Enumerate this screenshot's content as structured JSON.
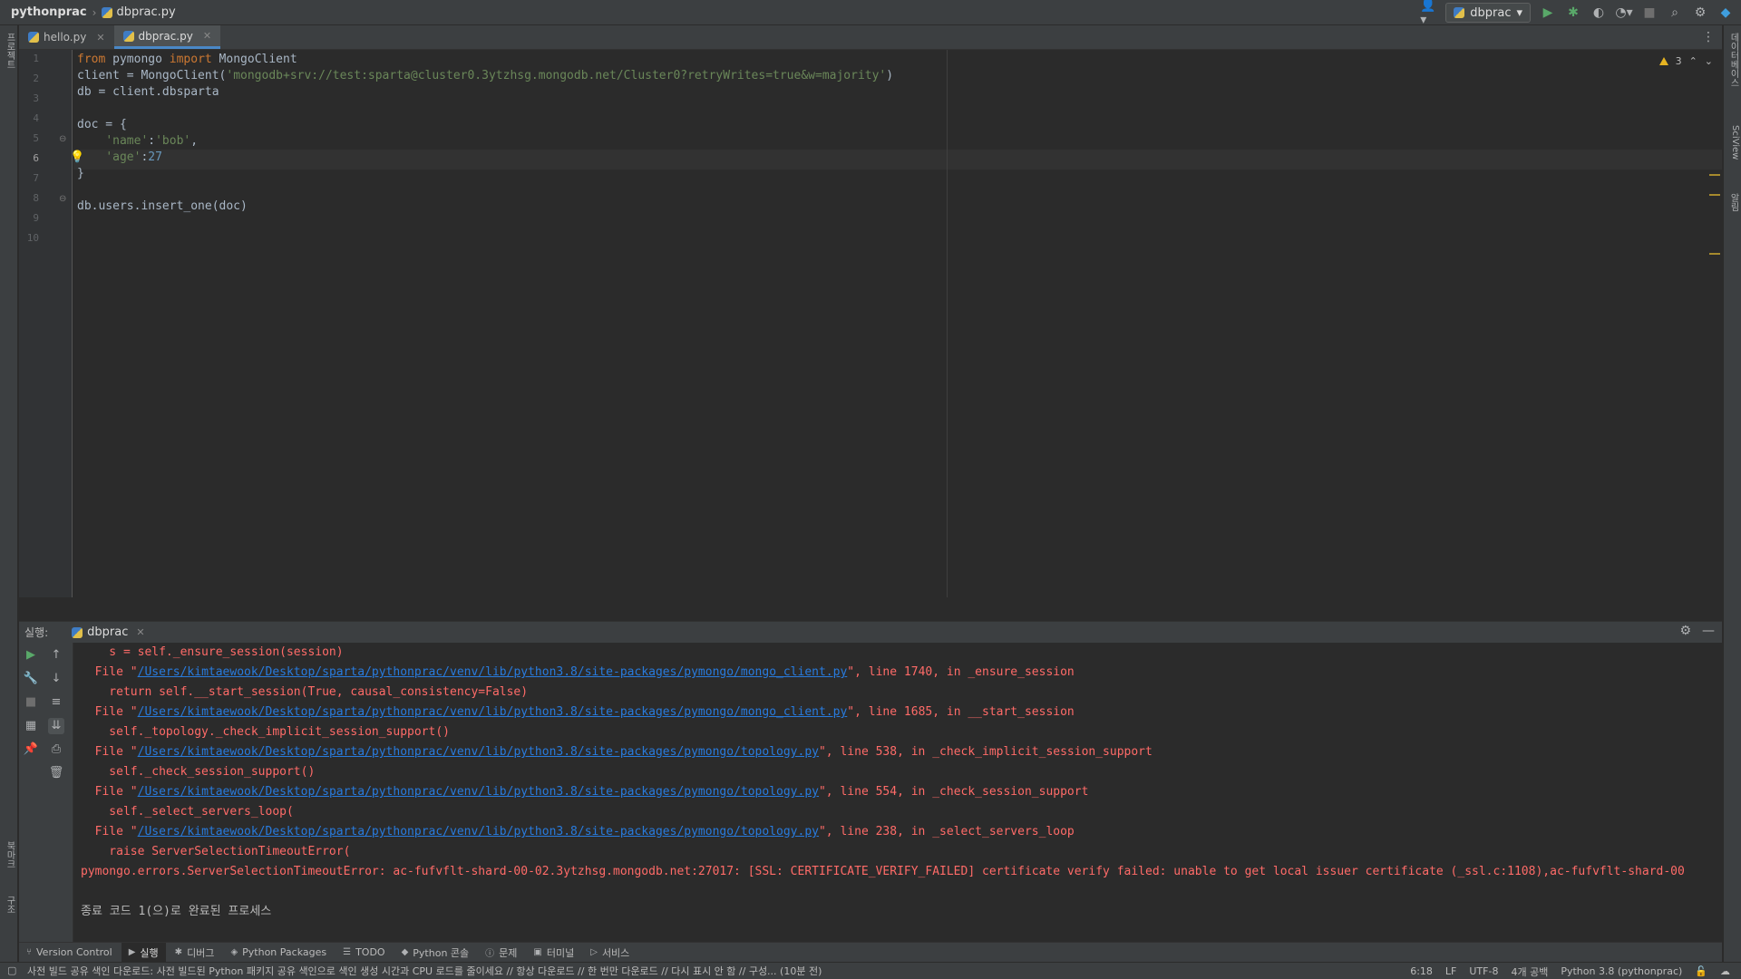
{
  "nav": {
    "project": "pythonprac",
    "file": "dbprac.py",
    "run_config": "dbprac"
  },
  "editor_tabs": [
    {
      "label": "hello.py"
    },
    {
      "label": "dbprac.py"
    }
  ],
  "inspection": {
    "warnings": "3"
  },
  "line_numbers": [
    "1",
    "2",
    "3",
    "4",
    "5",
    "6",
    "7",
    "8",
    "9",
    "10"
  ],
  "code": {
    "l1": {
      "k1": "from",
      "t1": " pymongo ",
      "k2": "import",
      "t2": " MongoClient"
    },
    "l2": {
      "t1": "client = MongoClient(",
      "s1": "'mongodb+srv://test:sparta@cluster0.3ytzhsg.mongodb.net/Cluster0?retryWrites=true&w=majority'",
      "t2": ")"
    },
    "l3": "db = client.dbsparta",
    "l5": "doc = {",
    "l6": {
      "s1": "'name'",
      "t1": ":",
      "s2": "'bob'",
      "t2": ","
    },
    "l7": {
      "s1": "'age'",
      "t1": ":",
      "n1": "27"
    },
    "l8": "}",
    "l10": "db.users.insert_one(doc)"
  },
  "run_panel": {
    "label": "실행:",
    "tab": "dbprac"
  },
  "console": [
    {
      "pre": "    s = self._ensure_session(session)"
    },
    {
      "pre": "  File \"",
      "link": "/Users/kimtaewook/Desktop/sparta/pythonprac/venv/lib/python3.8/site-packages/pymongo/mongo_client.py",
      "post": "\", line 1740, in _ensure_session"
    },
    {
      "pre": "    return self.__start_session(True, causal_consistency=False)"
    },
    {
      "pre": "  File \"",
      "link": "/Users/kimtaewook/Desktop/sparta/pythonprac/venv/lib/python3.8/site-packages/pymongo/mongo_client.py",
      "post": "\", line 1685, in __start_session"
    },
    {
      "pre": "    self._topology._check_implicit_session_support()"
    },
    {
      "pre": "  File \"",
      "link": "/Users/kimtaewook/Desktop/sparta/pythonprac/venv/lib/python3.8/site-packages/pymongo/topology.py",
      "post": "\", line 538, in _check_implicit_session_support"
    },
    {
      "pre": "    self._check_session_support()"
    },
    {
      "pre": "  File \"",
      "link": "/Users/kimtaewook/Desktop/sparta/pythonprac/venv/lib/python3.8/site-packages/pymongo/topology.py",
      "post": "\", line 554, in _check_session_support"
    },
    {
      "pre": "    self._select_servers_loop("
    },
    {
      "pre": "  File \"",
      "link": "/Users/kimtaewook/Desktop/sparta/pythonprac/venv/lib/python3.8/site-packages/pymongo/topology.py",
      "post": "\", line 238, in _select_servers_loop"
    },
    {
      "pre": "    raise ServerSelectionTimeoutError("
    },
    {
      "pre": "pymongo.errors.ServerSelectionTimeoutError: ac-fufvflt-shard-00-02.3ytzhsg.mongodb.net:27017: [SSL: CERTIFICATE_VERIFY_FAILED] certificate verify failed: unable to get local issuer certificate (_ssl.c:1108),ac-fufvflt-shard-00"
    },
    {
      "pre": ""
    },
    {
      "pre": "종료 코드 1(으)로 완료된 프로세스"
    }
  ],
  "bottom_tools": [
    {
      "label": "Version Control"
    },
    {
      "label": "실행"
    },
    {
      "label": "디버그"
    },
    {
      "label": "Python Packages"
    },
    {
      "label": "TODO"
    },
    {
      "label": "Python 콘솔"
    },
    {
      "label": "문제"
    },
    {
      "label": "터미널"
    },
    {
      "label": "서비스"
    }
  ],
  "status": {
    "message": "사전 빌드 공유 색인 다운로드: 사전 빌드된 Python 패키지 공유 색인으로 색인 생성 시간과 CPU 로드를 줄이세요 // 항상 다운로드 // 한 번만 다운로드 // 다시 표시 안 함 // 구성... (10분 전)",
    "position": "6:18",
    "line_sep": "LF",
    "encoding": "UTF-8",
    "indent": "4개 공백",
    "interpreter": "Python 3.8 (pythonprac)"
  },
  "side_labels": {
    "left_top": "프로젝트",
    "left_bottom1": "북마크",
    "left_bottom2": "구조",
    "right_top": "데이터베이스",
    "right_mid": "SciView",
    "right_bot": "알림"
  }
}
